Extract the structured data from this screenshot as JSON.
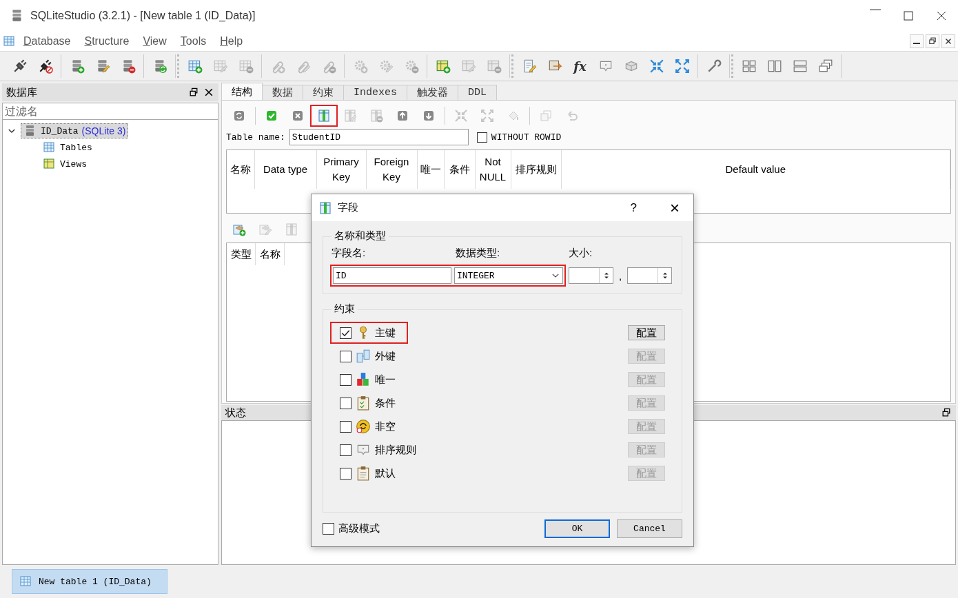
{
  "window": {
    "title": "SQLiteStudio (3.2.1) - [New table 1 (ID_Data)]"
  },
  "menu": [
    {
      "label": "Database"
    },
    {
      "label": "Structure"
    },
    {
      "label": "View"
    },
    {
      "label": "Tools"
    },
    {
      "label": "Help"
    }
  ],
  "toolbar": {
    "groups": [
      [
        {
          "disabled": false
        },
        {
          "disabled": false
        }
      ],
      [
        {
          "disabled": false
        },
        {
          "disabled": false
        },
        {
          "disabled": false
        }
      ],
      [
        {
          "disabled": false
        }
      ],
      [
        {
          "disabled": false
        },
        {
          "disabled": true
        },
        {
          "disabled": true
        }
      ],
      [
        {
          "disabled": true
        },
        {
          "disabled": true
        },
        {
          "disabled": true
        }
      ],
      [
        {
          "disabled": true
        },
        {
          "disabled": true
        },
        {
          "disabled": true
        }
      ],
      [
        {
          "disabled": false
        },
        {
          "disabled": true
        },
        {
          "disabled": true
        }
      ],
      [
        {
          "disabled": false
        },
        {
          "disabled": false
        },
        {
          "disabled": false,
          "glyph": "fx"
        },
        {
          "disabled": false
        },
        {
          "disabled": false
        },
        {
          "disabled": false
        },
        {
          "disabled": false
        }
      ],
      [
        {
          "disabled": false
        }
      ],
      [
        {
          "disabled": false
        },
        {
          "disabled": false
        },
        {
          "disabled": false
        },
        {
          "disabled": false
        }
      ]
    ]
  },
  "db_panel": {
    "title": "数据库",
    "filter_placeholder": "过滤名",
    "tree": [
      {
        "label": "ID_Data",
        "note": "(SQLite 3)",
        "expanded": true,
        "selected": true,
        "children": [
          {
            "label": "Tables",
            "selected": false
          },
          {
            "label": "Views",
            "selected": false
          }
        ]
      }
    ]
  },
  "editor": {
    "tabs": [
      {
        "label": "结构",
        "selected": true
      },
      {
        "label": "数据",
        "selected": false
      },
      {
        "label": "约束",
        "selected": false
      },
      {
        "label": "Indexes",
        "selected": false
      },
      {
        "label": "触发器",
        "selected": false
      },
      {
        "label": "DDL",
        "selected": false
      }
    ],
    "toolbar": [
      {
        "disabled": false,
        "highlighted": false
      },
      {
        "disabled": false,
        "highlighted": false
      },
      {
        "disabled": false,
        "highlighted": false
      },
      {
        "disabled": false,
        "highlighted": true
      },
      {
        "disabled": true,
        "highlighted": false
      },
      {
        "disabled": true,
        "highlighted": false
      },
      {
        "disabled": false,
        "highlighted": false
      },
      {
        "disabled": false,
        "highlighted": false
      },
      {
        "disabled": true,
        "highlighted": false
      },
      {
        "disabled": true,
        "highlighted": false
      },
      {
        "disabled": true,
        "highlighted": false
      },
      {
        "disabled": true,
        "highlighted": false
      },
      {
        "disabled": true,
        "highlighted": false
      }
    ],
    "table_name_label": "Table name:",
    "table_name": "StudentID",
    "without_rowid": {
      "label": "WITHOUT ROWID",
      "checked": false
    },
    "columns": [
      "名称",
      "Data type",
      "Primary Key",
      "Foreign Key",
      "唯一",
      "条件",
      "Not NULL",
      "排序规则",
      "Default value"
    ],
    "constraint_toolbar": [
      {
        "disabled": false
      },
      {
        "disabled": true
      },
      {
        "disabled": true
      }
    ],
    "constraint_columns": [
      "类型",
      "名称"
    ]
  },
  "status": {
    "title": "状态"
  },
  "taskbar": [
    {
      "label": "New table 1 (ID_Data)",
      "selected": true
    }
  ],
  "dialog": {
    "title": "字段",
    "help": "?",
    "close": "×",
    "name_type": {
      "title": "名称和类型",
      "name_label": "字段名:",
      "type_label": "数据类型:",
      "size_label": "大小:",
      "name": "ID",
      "type": "INTEGER",
      "separator": ",",
      "highlighted": true
    },
    "constraints": {
      "title": "约束",
      "items": [
        {
          "label": "主键",
          "checked": true,
          "highlighted": true,
          "button": "配置",
          "button_disabled": false
        },
        {
          "label": "外键",
          "checked": false,
          "highlighted": false,
          "button": "配置",
          "button_disabled": true
        },
        {
          "label": "唯一",
          "checked": false,
          "highlighted": false,
          "button": "配置",
          "button_disabled": true
        },
        {
          "label": "条件",
          "checked": false,
          "highlighted": false,
          "button": "配置",
          "button_disabled": true
        },
        {
          "label": "非空",
          "checked": false,
          "highlighted": false,
          "button": "配置",
          "button_disabled": true
        },
        {
          "label": "排序规则",
          "checked": false,
          "highlighted": false,
          "button": "配置",
          "button_disabled": true
        },
        {
          "label": "默认",
          "checked": false,
          "highlighted": false,
          "button": "配置",
          "button_disabled": true
        }
      ]
    },
    "advanced": {
      "label": "高级模式",
      "checked": false
    },
    "ok": "OK",
    "cancel": "Cancel"
  }
}
